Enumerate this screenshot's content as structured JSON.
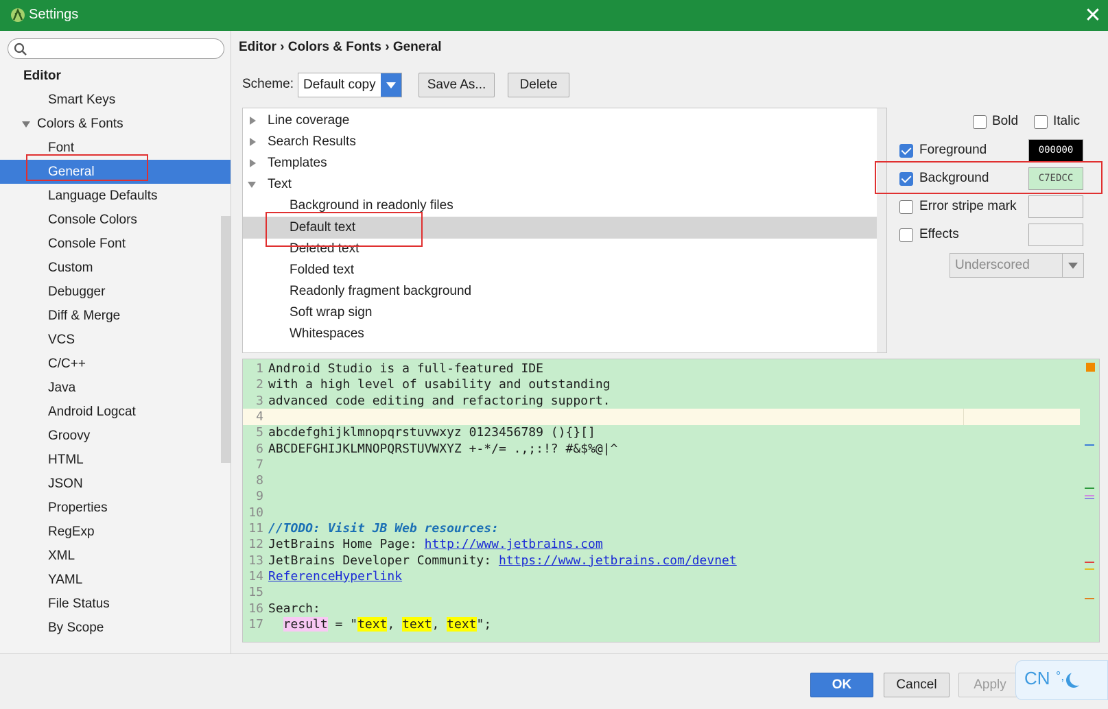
{
  "window": {
    "title": "Settings",
    "close": "✕"
  },
  "sidebar": {
    "search_placeholder": "",
    "items": [
      {
        "label": "Editor",
        "level": 0
      },
      {
        "label": "Smart Keys",
        "level": 2
      },
      {
        "label": "Colors & Fonts",
        "level": 1
      },
      {
        "label": "Font",
        "level": 2
      },
      {
        "label": "General",
        "level": 2,
        "selected": true
      },
      {
        "label": "Language Defaults",
        "level": 2
      },
      {
        "label": "Console Colors",
        "level": 2
      },
      {
        "label": "Console Font",
        "level": 2
      },
      {
        "label": "Custom",
        "level": 2
      },
      {
        "label": "Debugger",
        "level": 2
      },
      {
        "label": "Diff & Merge",
        "level": 2
      },
      {
        "label": "VCS",
        "level": 2
      },
      {
        "label": "C/C++",
        "level": 2
      },
      {
        "label": "Java",
        "level": 2
      },
      {
        "label": "Android Logcat",
        "level": 2
      },
      {
        "label": "Groovy",
        "level": 2
      },
      {
        "label": "HTML",
        "level": 2
      },
      {
        "label": "JSON",
        "level": 2
      },
      {
        "label": "Properties",
        "level": 2
      },
      {
        "label": "RegExp",
        "level": 2
      },
      {
        "label": "XML",
        "level": 2
      },
      {
        "label": "YAML",
        "level": 2
      },
      {
        "label": "File Status",
        "level": 2
      },
      {
        "label": "By Scope",
        "level": 2
      }
    ]
  },
  "breadcrumb": "Editor › Colors & Fonts › General",
  "scheme": {
    "label": "Scheme:",
    "value": "Default copy",
    "save_as": "Save As...",
    "delete": "Delete"
  },
  "attributes": [
    {
      "label": "Line coverage",
      "kind": "collapsed"
    },
    {
      "label": "Search Results",
      "kind": "collapsed"
    },
    {
      "label": "Templates",
      "kind": "collapsed"
    },
    {
      "label": "Text",
      "kind": "expanded"
    },
    {
      "label": "Background in readonly files",
      "kind": "child"
    },
    {
      "label": "Default text",
      "kind": "child",
      "selected": true
    },
    {
      "label": "Deleted text",
      "kind": "child"
    },
    {
      "label": "Folded text",
      "kind": "child"
    },
    {
      "label": "Readonly fragment background",
      "kind": "child"
    },
    {
      "label": "Soft wrap sign",
      "kind": "child"
    },
    {
      "label": "Whitespaces",
      "kind": "child"
    }
  ],
  "properties": {
    "bold": {
      "label": "Bold",
      "checked": false
    },
    "italic": {
      "label": "Italic",
      "checked": false
    },
    "foreground": {
      "label": "Foreground",
      "checked": true,
      "value": "000000",
      "color": "#000000",
      "text_color": "#ffffff"
    },
    "background": {
      "label": "Background",
      "checked": true,
      "value": "C7EDCC",
      "color": "#c7edcc",
      "text_color": "#4a4a4a"
    },
    "error_stripe": {
      "label": "Error stripe mark",
      "checked": false
    },
    "effects": {
      "label": "Effects",
      "checked": false,
      "effect_type": "Underscored"
    }
  },
  "preview": {
    "lines": [
      {
        "n": "1",
        "text": "Android Studio is a full-featured IDE"
      },
      {
        "n": "2",
        "text": "with a high level of usability and outstanding"
      },
      {
        "n": "3",
        "text": "advanced code editing and refactoring support."
      },
      {
        "n": "4",
        "text": "",
        "current": true
      },
      {
        "n": "5",
        "text": "abcdefghijklmnopqrstuvwxyz 0123456789 (){}[]"
      },
      {
        "n": "6",
        "text": "ABCDEFGHIJKLMNOPQRSTUVWXYZ +-*/= .,;:!? #&$%@|^"
      },
      {
        "n": "7",
        "text": ""
      },
      {
        "n": "8",
        "text": ""
      },
      {
        "n": "9",
        "text": ""
      },
      {
        "n": "10",
        "text": ""
      },
      {
        "n": "11",
        "text": "//TODO: Visit JB Web resources:",
        "style": "todo"
      },
      {
        "n": "12",
        "prefix": "JetBrains Home Page: ",
        "link": "http://www.jetbrains.com"
      },
      {
        "n": "13",
        "prefix": "JetBrains Developer Community: ",
        "link": "https://www.jetbrains.com/devnet"
      },
      {
        "n": "14",
        "prefix": "",
        "link": "ReferenceHyperlink"
      },
      {
        "n": "15",
        "text": ""
      },
      {
        "n": "16",
        "text": "Search:"
      },
      {
        "n": "17",
        "search": {
          "var": "result",
          "eq": " = \"",
          "w1": "text",
          "sep1": ", ",
          "w2": "text",
          "sep2": ", ",
          "w3": "text",
          "end": "\";"
        }
      }
    ],
    "markers": [
      {
        "color": "#3d7dd8",
        "top": 0.3
      },
      {
        "color": "#2e9a3e",
        "top": 0.455
      },
      {
        "color": "#d08ae0",
        "top": 0.48
      },
      {
        "color": "#8a8ae0",
        "top": 0.49
      },
      {
        "color": "#e04040",
        "top": 0.715
      },
      {
        "color": "#e0c020",
        "top": 0.74
      },
      {
        "color": "#e08020",
        "top": 0.845
      }
    ]
  },
  "buttons": {
    "ok": "OK",
    "cancel": "Cancel",
    "apply": "Apply"
  },
  "ime": {
    "lang": "CN",
    "dots": "°,"
  },
  "colors": {
    "accent": "#3d7dd8",
    "titlebar": "#1e8e3e",
    "highlight_box": "#e03030"
  }
}
